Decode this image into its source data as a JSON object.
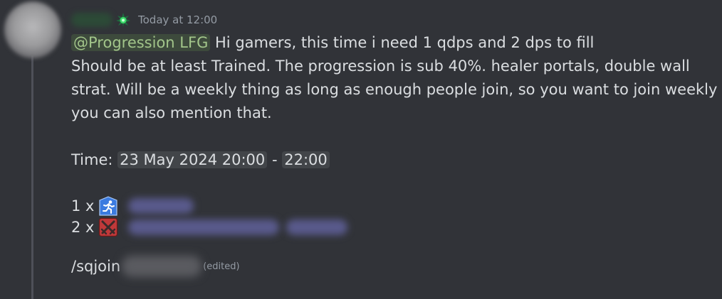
{
  "message": {
    "timestamp": "Today at 12:00",
    "mention": "@Progression LFG",
    "line1_rest": " Hi gamers, this time i need 1 qdps and 2 dps to fill",
    "line2": "Should be at least Trained. The progression is sub 40%. healer portals, double wall",
    "line3": "strat. Will be a weekly thing as long as enough people join, so you want to join weekly",
    "line4": "you can also mention that.",
    "time_label": "Time:",
    "time_start": "23 May 2024 20:00",
    "time_separator": "-",
    "time_end": "22:00",
    "roles": [
      {
        "count_label": "1 x",
        "icon": "qdps-runner-icon"
      },
      {
        "count_label": "2 x",
        "icon": "dps-crossed-swords-icon"
      }
    ],
    "command": "/sqjoin",
    "edited_label": "(edited)"
  },
  "colors": {
    "background": "#313338",
    "text": "#dbdee1",
    "muted": "#949ba4",
    "mention_text": "#a2c58a",
    "qdps_icon_bg": "#3b7be0",
    "dps_icon_bg": "#c0393a"
  }
}
